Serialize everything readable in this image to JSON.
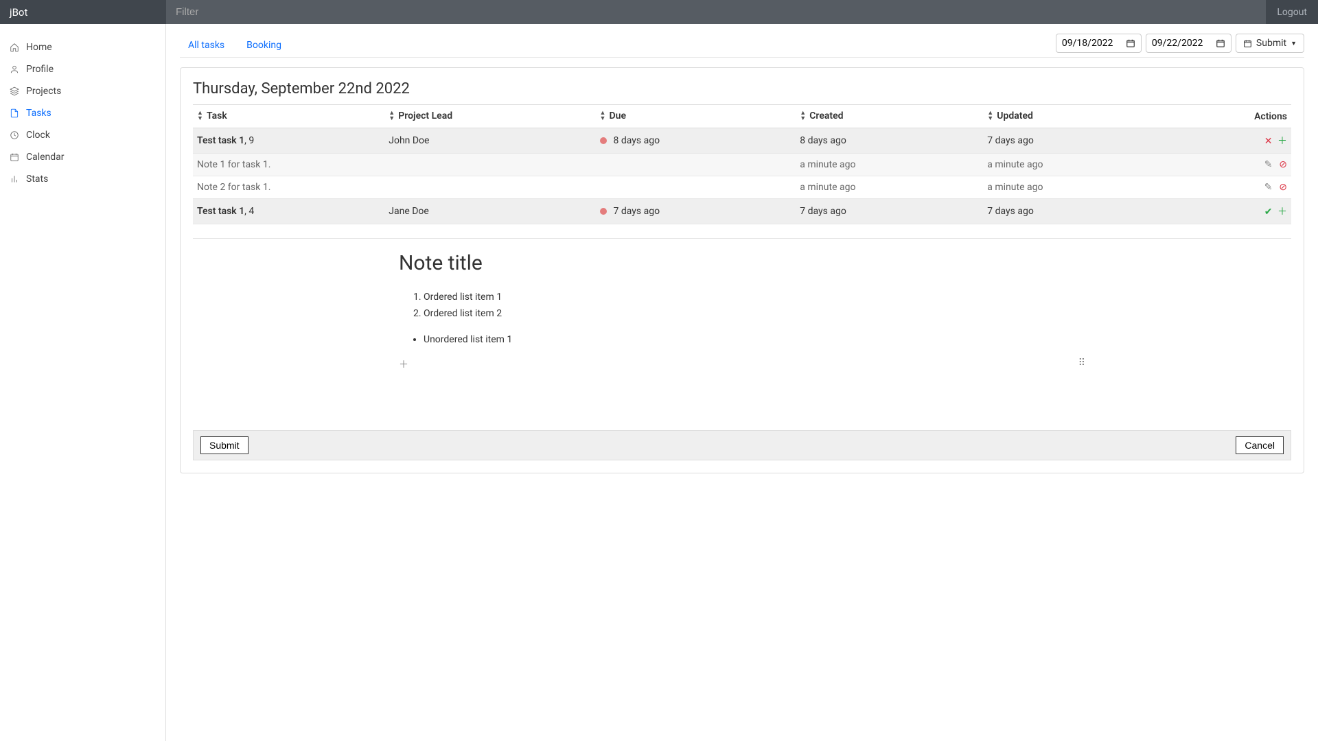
{
  "app": {
    "name": "jBot"
  },
  "header": {
    "filter_placeholder": "Filter",
    "logout": "Logout"
  },
  "sidebar": {
    "items": [
      {
        "label": "Home"
      },
      {
        "label": "Profile"
      },
      {
        "label": "Projects"
      },
      {
        "label": "Tasks"
      },
      {
        "label": "Clock"
      },
      {
        "label": "Calendar"
      },
      {
        "label": "Stats"
      }
    ]
  },
  "tabs": [
    {
      "label": "All tasks"
    },
    {
      "label": "Booking"
    }
  ],
  "dates": {
    "from": "09/18/2022",
    "to": "09/22/2022",
    "submit_label": "Submit"
  },
  "group": {
    "heading": "Thursday, September 22nd 2022"
  },
  "columns": {
    "task": "Task",
    "lead": "Project Lead",
    "due": "Due",
    "created": "Created",
    "updated": "Updated",
    "actions": "Actions"
  },
  "rows": [
    {
      "task": "Test task 1",
      "badge": ", 9",
      "lead": "John Doe",
      "due": "8 days ago",
      "created": "8 days ago",
      "updated": "7 days ago"
    },
    {
      "note": "Note 1 for task 1.",
      "created": "a minute ago",
      "updated": "a minute ago"
    },
    {
      "note": "Note 2 for task 1.",
      "created": "a minute ago",
      "updated": "a minute ago"
    },
    {
      "task": "Test task 1",
      "badge": ", 4",
      "lead": "Jane Doe",
      "due": "7 days ago",
      "created": "7 days ago",
      "updated": "7 days ago"
    }
  ],
  "editor": {
    "title": "Note title",
    "ol": [
      "Ordered list item 1",
      "Ordered list item 2"
    ],
    "ul": [
      "Unordered list item 1"
    ],
    "submit": "Submit",
    "cancel": "Cancel"
  }
}
